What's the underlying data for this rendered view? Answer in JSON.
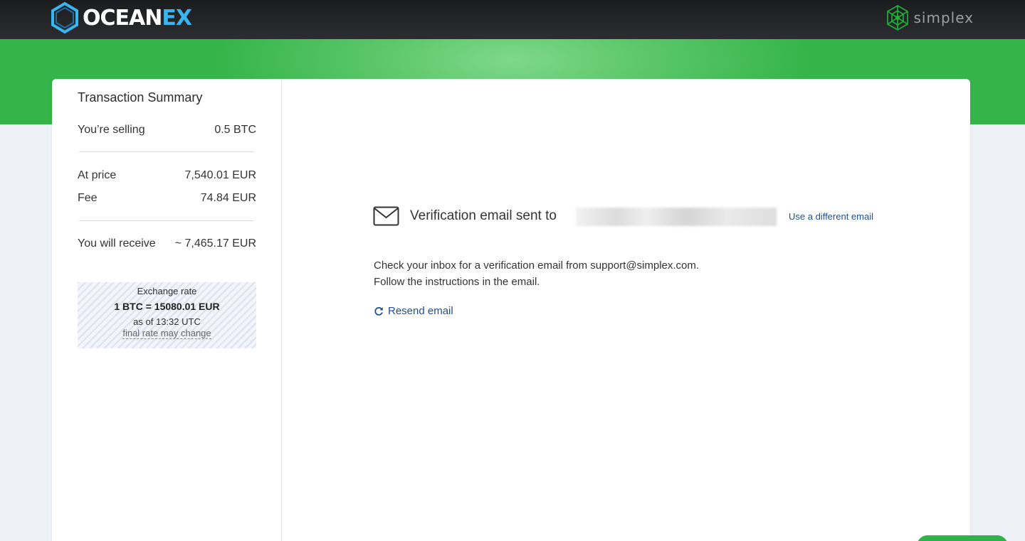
{
  "header": {
    "brand_left": {
      "name": "OCEANEX",
      "text_main": "OCEAN",
      "text_accent": "EX",
      "accent_color": "#39b5f0"
    },
    "brand_right": {
      "name": "simplex",
      "text": "simplex",
      "color": "#1fb53a"
    }
  },
  "summary": {
    "title": "Transaction Summary",
    "selling_label": "You’re selling",
    "selling_value": "0.5 BTC",
    "price_label": "At price",
    "price_value": "7,540.01 EUR",
    "fee_label": "Fee",
    "fee_value": "74.84 EUR",
    "receive_label": "You will receive",
    "receive_value": "~ 7,465.17 EUR",
    "rate": {
      "label": "Exchange rate",
      "value": "1 BTC = 15080.01 EUR",
      "time": "as of 13:32 UTC",
      "note": "final rate may change"
    }
  },
  "verification": {
    "title": "Verification email sent to",
    "use_different": "Use a different email",
    "line1": "Check your inbox for a verification email from support@simplex.com.",
    "line2": "Follow the instructions in the email.",
    "resend": "Resend email"
  },
  "colors": {
    "green": "#35b449",
    "link": "#1f4f8f",
    "topbar": "#1b1c1e"
  }
}
